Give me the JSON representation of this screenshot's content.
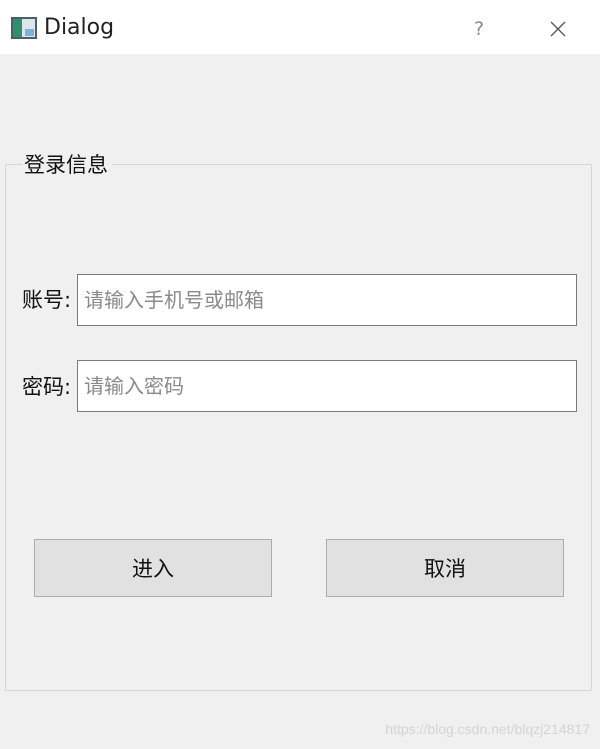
{
  "window": {
    "title": "Dialog",
    "help_label": "?",
    "icon": "app-window-icon",
    "close_icon": "close-icon"
  },
  "form": {
    "group_title": "登录信息",
    "account": {
      "label": "账号:",
      "value": "",
      "placeholder": "请输入手机号或邮箱"
    },
    "password": {
      "label": "密码:",
      "value": "",
      "placeholder": "请输入密码"
    },
    "buttons": {
      "enter_label": "进入",
      "cancel_label": "取消"
    }
  },
  "watermark": "https://blog.csdn.net/blqzj214817",
  "colors": {
    "window_background": "#f0f0f0",
    "titlebar_background": "#ffffff",
    "button_background": "#e1e1e1",
    "button_border": "#adadad",
    "input_border": "#7a7a7a",
    "placeholder_text": "#8a8a8a"
  }
}
